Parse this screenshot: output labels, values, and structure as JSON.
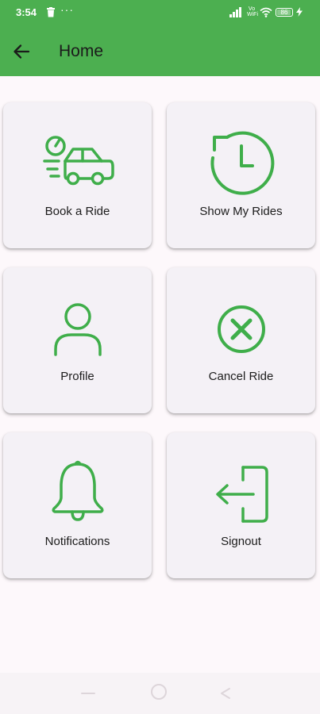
{
  "status_bar": {
    "time": "3:54",
    "network_label": "Vo\nWiFi",
    "battery_level": "86",
    "icons": [
      "trash-icon",
      "more-dots-icon",
      "signal-icon",
      "volte-icon",
      "wifi-icon",
      "battery-icon",
      "charging-bolt-icon"
    ]
  },
  "app_bar": {
    "title": "Home",
    "back_icon": "arrow-left-icon"
  },
  "tiles": [
    {
      "label": "Book a Ride",
      "icon": "car-speed-icon"
    },
    {
      "label": "Show My Rides",
      "icon": "history-clock-icon"
    },
    {
      "label": "Profile",
      "icon": "person-icon"
    },
    {
      "label": "Cancel Ride",
      "icon": "cancel-circle-icon"
    },
    {
      "label": "Notifications",
      "icon": "bell-icon"
    },
    {
      "label": "Signout",
      "icon": "logout-icon"
    }
  ],
  "nav_bar": {
    "icons": [
      "recent-apps-icon",
      "home-circle-icon",
      "back-triangle-icon"
    ]
  },
  "colors": {
    "accent": "#4caf50",
    "icon": "#3fae4a",
    "tile_bg": "#f4f1f6",
    "page_bg": "#fdf8fb"
  }
}
